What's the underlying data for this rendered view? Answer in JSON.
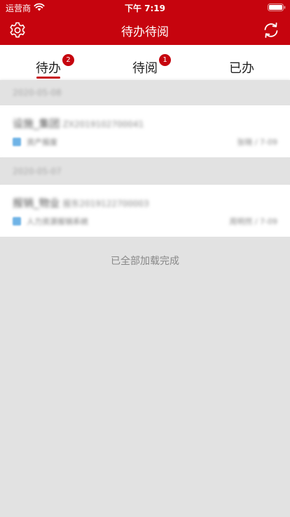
{
  "status_bar": {
    "carrier": "运营商",
    "time": "下午 7:19"
  },
  "nav": {
    "title": "待办待阅"
  },
  "tabs": [
    {
      "label": "待办",
      "badge": "2",
      "active": true
    },
    {
      "label": "待阅",
      "badge": "1",
      "active": false
    },
    {
      "label": "已办",
      "badge": "",
      "active": false
    }
  ],
  "groups": [
    {
      "date": "2020-05-08",
      "items": [
        {
          "title": "设施_集团",
          "code": "ZX2019102700041",
          "type": "资产报废",
          "meta": "张晓 / 7-09"
        }
      ]
    },
    {
      "date": "2020-05-07",
      "items": [
        {
          "title": "报销_物业",
          "code": "报东2019122700003",
          "type": "人力资源报销系统",
          "meta": "周明然 / 7-09"
        }
      ]
    }
  ],
  "footer": {
    "load_status": "已全部加载完成"
  },
  "colors": {
    "brand": "#c6040e",
    "background": "#e2e2e2",
    "type_icon": "#6fb3e6"
  }
}
